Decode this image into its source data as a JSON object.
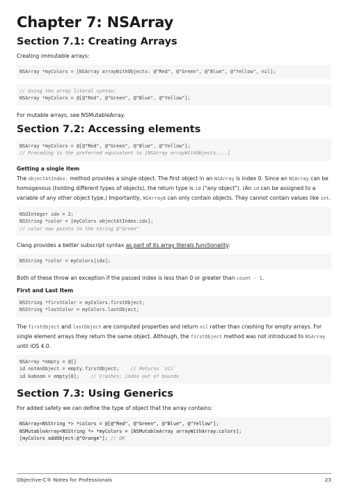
{
  "chapter_title": "Chapter 7: NSArray",
  "s1": {
    "title": "Section 7.1: Creating Arrays",
    "intro": "Creating immutable arrays:",
    "code1": [
      "NSArray *myColors = [NSArray arrayWithObjects: @\"Red\", @\"Green\", @\"Blue\", @\"Yellow\", nil];"
    ],
    "code2_comment": "// Using the array literal syntax:",
    "code2": "NSArray *myColors = @[@\"Red\", @\"Green\", @\"Blue\", @\"Yellow\"];",
    "outro": "For mutable arrays, see NSMutableArray."
  },
  "s2": {
    "title": "Section 7.2: Accessing elements",
    "code1": "NSArray *myColors = @[@\"Red\", @\"Green\", @\"Blue\", @\"Yellow\"];",
    "code1_comment": "// Preceding is the preferred equivalent to [NSArray arrayWithObjects:...]",
    "sub1": "Getting a single item",
    "para1": {
      "t1": "The ",
      "c1": "objectAtIndex:",
      "t2": " method provides a single object. The first object in an ",
      "c2": "NSArray",
      "t3": " is index 0. Since an ",
      "c3": "NSArray",
      "t4": " can be homogenous (holding different types of objects), the return type is ",
      "c4": "id",
      "t5": " (\"any object\"). (An ",
      "c5": "id",
      "t6": " can be assigned to a variable of any other object type.) Importantly, ",
      "c6": "NSArray",
      "t7": "s can only contain objects. They cannot contain values like ",
      "c7": "int",
      "t8": "."
    },
    "code2": [
      "NSUInteger idx = 2;",
      "NSString *color = [myColors objectAtIndex:idx];"
    ],
    "code2_comment": "// color now points to the string @\"Green\"",
    "para2_a": "Clang provides a better subscript syntax ",
    "para2_link": "as part of its array literals functionality",
    "para2_b": ":",
    "code3": "NSString *color = myColors[idx];",
    "para3_a": "Both of these throw an exception if the passed index is less than 0 or greater than ",
    "para3_code": "count - 1",
    "para3_b": ".",
    "sub2": "First and Last Item",
    "code4": [
      "NSString *firstColor = myColors.firstObject;",
      "NSString *lastColor = myColors.lastObject;"
    ],
    "para4": {
      "t1": "The ",
      "c1": "firstObject",
      "t2": " and ",
      "c2": "lastObject",
      "t3": " are computed properties and return ",
      "c3": "nil",
      "t4": " rather than crashing for empty arrays. For single element arrays they return the same object. Although, the ",
      "c4": "firstObject",
      "t5": " method was not introduced to ",
      "c5": "NSArray",
      "t6": " until iOS 4.0."
    },
    "code5_l1": "NSArray *empty = @[]",
    "code5_l2": "id notAnObject = empty.firstObject;",
    "code5_l2c": "// Returns `nil`",
    "code5_l3": "id kaboom = empty[0];",
    "code5_l3c": "// Crashes; index out of bounds"
  },
  "s3": {
    "title": "Section 7.3: Using Generics",
    "intro": "For added safety we can define the type of object that the array contains:",
    "code": [
      "NSArray<NSString *> *colors = @[@\"Red\", @\"Green\", @\"Blue\", @\"Yellow\"];",
      "NSMutableArray<NSString *> *myColors = [NSMutableArray arrayWithArray:colors];"
    ],
    "code_l3": "[myColors addObject:@\"Orange\"];",
    "code_l3c": "// OK"
  },
  "footer": {
    "book": "Objective-C® Notes for Professionals",
    "page": "23"
  }
}
